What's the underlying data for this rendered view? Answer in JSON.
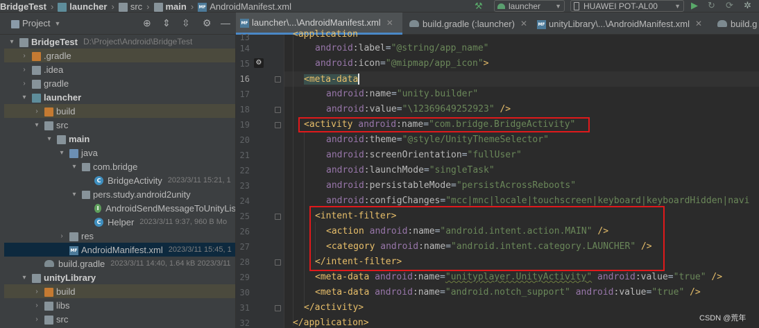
{
  "breadcrumb": {
    "items": [
      "BridgeTest",
      "launcher",
      "src",
      "main",
      "AndroidManifest.xml"
    ]
  },
  "toolbar": {
    "run_config": "launcher",
    "device": "HUAWEI POT-AL00"
  },
  "project_panel": {
    "title": "Project",
    "rows": [
      {
        "label": "BridgeTest",
        "meta": "D:\\Project\\Android\\BridgeTest"
      },
      {
        "label": ".gradle"
      },
      {
        "label": ".idea"
      },
      {
        "label": "gradle"
      },
      {
        "label": "launcher"
      },
      {
        "label": "build"
      },
      {
        "label": "src"
      },
      {
        "label": "main"
      },
      {
        "label": "java"
      },
      {
        "label": "com.bridge"
      },
      {
        "label": "BridgeActivity",
        "meta": "2023/3/11 15:21, 1"
      },
      {
        "label": "pers.study.android2unity"
      },
      {
        "label": "AndroidSendMessageToUnityLis"
      },
      {
        "label": "Helper",
        "meta": "2023/3/11 9:37, 960 B Mo"
      },
      {
        "label": "res"
      },
      {
        "label": "AndroidManifest.xml",
        "meta": "2023/3/11 15:45, 1"
      },
      {
        "label": "build.gradle",
        "meta": "2023/3/11 14:40, 1.64 kB 2023/3/11"
      },
      {
        "label": "unityLibrary"
      },
      {
        "label": "build"
      },
      {
        "label": "libs"
      },
      {
        "label": "src"
      }
    ]
  },
  "tabs": [
    {
      "label": "launcher\\...\\AndroidManifest.xml"
    },
    {
      "label": "build.gradle (:launcher)"
    },
    {
      "label": "unityLibrary\\...\\AndroidManifest.xml"
    },
    {
      "label": "build.g"
    }
  ],
  "editor": {
    "lines": [
      {
        "n": "13",
        "text": "<application"
      },
      {
        "n": "14",
        "attr": "label",
        "val": "\"@string/app_name\""
      },
      {
        "n": "15",
        "attr": "icon",
        "val": "\"@mipmap/app_icon\""
      },
      {
        "n": "16",
        "tag": "<meta-data"
      },
      {
        "n": "17",
        "attr": "name",
        "val": "\"unity.builder\""
      },
      {
        "n": "18",
        "attr": "value",
        "val": "\"\\12369649252923\"",
        "tail": " />"
      },
      {
        "n": "19",
        "tag": "<activity",
        "attr": "name",
        "val": "\"com.bridge.BridgeActivity\""
      },
      {
        "n": "20",
        "attr": "theme",
        "val": "\"@style/UnityThemeSelector\""
      },
      {
        "n": "21",
        "attr": "screenOrientation",
        "val": "\"fullUser\""
      },
      {
        "n": "22",
        "attr": "launchMode",
        "val": "\"singleTask\""
      },
      {
        "n": "23",
        "attr": "persistableMode",
        "val": "\"persistAcrossReboots\""
      },
      {
        "n": "24",
        "attr": "configChanges",
        "val": "\"mcc|mnc|locale|touchscreen|keyboard|keyboardHidden|navi"
      },
      {
        "n": "25",
        "tag": "<intent-filter>"
      },
      {
        "n": "26",
        "tag": "<action",
        "attr": "name",
        "val": "\"android.intent.action.MAIN\"",
        "tail": " />"
      },
      {
        "n": "27",
        "tag": "<category",
        "attr": "name",
        "val": "\"android.intent.category.LAUNCHER\"",
        "tail": " />"
      },
      {
        "n": "28",
        "tag": "</intent-filter>"
      },
      {
        "n": "29",
        "tag": "<meta-data",
        "attr": "name",
        "val": "\"unityplayer.UnityActivity\"",
        "attr2": "value",
        "val2": "\"true\"",
        "tail": " />"
      },
      {
        "n": "30",
        "tag": "<meta-data",
        "attr": "name",
        "val": "\"android.notch_support\"",
        "attr2": "value",
        "val2": "\"true\"",
        "tail": " />"
      },
      {
        "n": "31",
        "tag": "</activity>"
      },
      {
        "n": "32",
        "tag": "</application>"
      }
    ],
    "ns": "android",
    "colon": ":",
    "eq": "="
  },
  "watermark": "CSDN @荒年"
}
